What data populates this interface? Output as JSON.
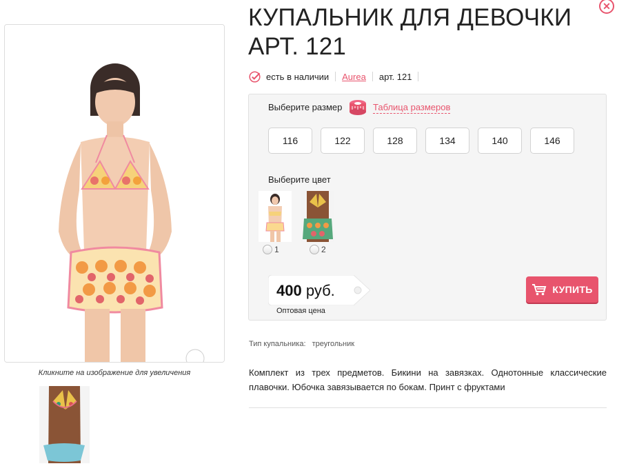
{
  "product": {
    "title": "КУПАЛЬНИК ДЛЯ ДЕВОЧКИ АРТ. 121",
    "availability": "есть в наличии",
    "brand": "Aurea",
    "article": "арт. 121"
  },
  "gallery": {
    "caption": "Кликните на изображение для увеличения"
  },
  "order": {
    "size_label": "Выберите размер",
    "size_table_link": "Таблица размеров",
    "sizes": [
      "116",
      "122",
      "128",
      "134",
      "140",
      "146"
    ],
    "color_label": "Выберите цвет",
    "colors": [
      "1",
      "2"
    ],
    "price_amount": "400",
    "price_currency": "руб.",
    "price_note": "Оптовая цена",
    "buy_label": "КУПИТЬ"
  },
  "attributes": {
    "type_label": "Тип купальника:",
    "type_value": "треугольник"
  },
  "description": "Комплект из трех предметов. Бикини на завязках. Однотонные классические плавочки. Юбочка завязывается по бокам. Принт с фруктами",
  "colors": {
    "accent": "#e8546d",
    "box_bg": "#f5f5f5"
  }
}
